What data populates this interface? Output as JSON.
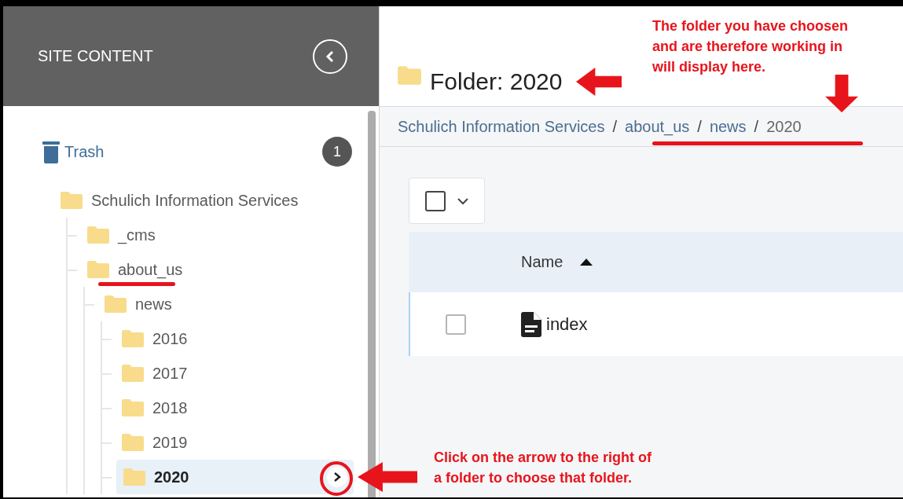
{
  "sidebar": {
    "title": "SITE CONTENT",
    "trash": {
      "label": "Trash",
      "count": "1"
    },
    "tree": [
      {
        "label": "Schulich Information Services",
        "selected": false,
        "children": [
          {
            "label": "_cms",
            "selected": false
          },
          {
            "label": "about_us",
            "selected": false,
            "children": [
              {
                "label": "news",
                "selected": false,
                "children": [
                  {
                    "label": "2016",
                    "selected": false
                  },
                  {
                    "label": "2017",
                    "selected": false
                  },
                  {
                    "label": "2018",
                    "selected": false
                  },
                  {
                    "label": "2019",
                    "selected": false
                  },
                  {
                    "label": "2020",
                    "selected": true
                  }
                ]
              }
            ]
          }
        ]
      }
    ]
  },
  "main": {
    "title": "Folder: 2020",
    "separator": "/",
    "breadcrumbs": [
      "Schulich Information Services",
      "about_us",
      "news",
      "2020"
    ],
    "table": {
      "select_all_checked": false,
      "columns": [
        {
          "label": "Name",
          "sorted_ascending": true
        }
      ],
      "rows": [
        {
          "name": "index",
          "checked": false
        }
      ]
    }
  },
  "annotations": [
    {
      "lines": [
        "The folder you have choosen",
        "and are therefore working in",
        "will display here."
      ]
    },
    {
      "lines": [
        "Click on the arrow to the right of",
        "a folder to choose that folder."
      ]
    }
  ]
}
